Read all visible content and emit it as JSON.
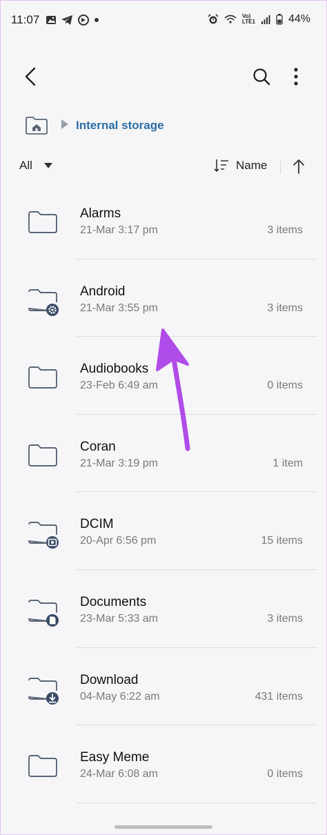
{
  "status_bar": {
    "time": "11:07",
    "battery": "44%",
    "network_top": "Vo)",
    "network_bottom": "LTE1"
  },
  "toolbar": {
    "back_icon": "back-arrow-icon",
    "search_icon": "search-icon",
    "more_icon": "more-vertical-icon"
  },
  "breadcrumb": {
    "current": "Internal storage"
  },
  "filter": {
    "label": "All",
    "sort_label": "Name"
  },
  "colors": {
    "accent": "#2a6fa6",
    "folder_stroke": "#5b6675",
    "badge": "#3a4a66",
    "annotation": "#b04ce8"
  },
  "items": [
    {
      "name": "Alarms",
      "date": "21-Mar 3:17 pm",
      "count": "3 items",
      "badge": ""
    },
    {
      "name": "Android",
      "date": "21-Mar 3:55 pm",
      "count": "3 items",
      "badge": "gear"
    },
    {
      "name": "Audiobooks",
      "date": "23-Feb 6:49 am",
      "count": "0 items",
      "badge": ""
    },
    {
      "name": "Coran",
      "date": "21-Mar 3:19 pm",
      "count": "1 item",
      "badge": ""
    },
    {
      "name": "DCIM",
      "date": "20-Apr 6:56 pm",
      "count": "15 items",
      "badge": "camera"
    },
    {
      "name": "Documents",
      "date": "23-Mar 5:33 am",
      "count": "3 items",
      "badge": "document"
    },
    {
      "name": "Download",
      "date": "04-May 6:22 am",
      "count": "431 items",
      "badge": "download"
    },
    {
      "name": "Easy Meme",
      "date": "24-Mar 6:08 am",
      "count": "0 items",
      "badge": ""
    }
  ]
}
